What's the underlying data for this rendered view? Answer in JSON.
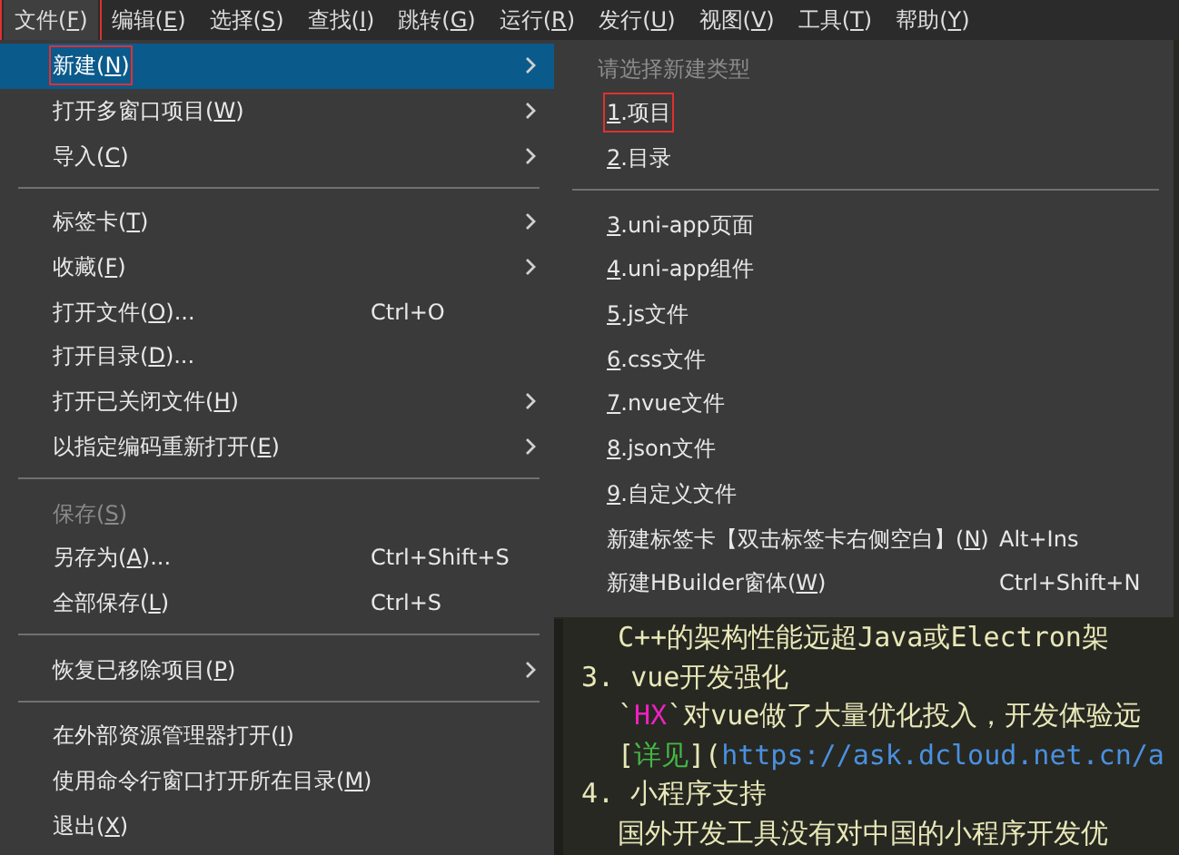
{
  "menubar": [
    {
      "pre": "文件(",
      "key": "F",
      "post": ")",
      "open": true,
      "annotated": true
    },
    {
      "pre": "编辑(",
      "key": "E",
      "post": ")",
      "open": false,
      "annotated": false
    },
    {
      "pre": "选择(",
      "key": "S",
      "post": ")",
      "open": false,
      "annotated": false
    },
    {
      "pre": "查找(",
      "key": "I",
      "post": ")",
      "open": false,
      "annotated": false
    },
    {
      "pre": "跳转(",
      "key": "G",
      "post": ")",
      "open": false,
      "annotated": false
    },
    {
      "pre": "运行(",
      "key": "R",
      "post": ")",
      "open": false,
      "annotated": false
    },
    {
      "pre": "发行(",
      "key": "U",
      "post": ")",
      "open": false,
      "annotated": false
    },
    {
      "pre": "视图(",
      "key": "V",
      "post": ")",
      "open": false,
      "annotated": false
    },
    {
      "pre": "工具(",
      "key": "T",
      "post": ")",
      "open": false,
      "annotated": false
    },
    {
      "pre": "帮助(",
      "key": "Y",
      "post": ")",
      "open": false,
      "annotated": false
    }
  ],
  "file_menu": [
    {
      "kind": "item",
      "pre": "新建(",
      "key": "N",
      "post": ")",
      "submenu": true,
      "selected": true,
      "disabled": false,
      "annotated": true
    },
    {
      "kind": "item",
      "pre": "打开多窗口项目(",
      "key": "W",
      "post": ")",
      "submenu": true,
      "selected": false,
      "disabled": false,
      "annotated": false
    },
    {
      "kind": "item",
      "pre": "导入(",
      "key": "C",
      "post": ")",
      "submenu": true,
      "selected": false,
      "disabled": false,
      "annotated": false
    },
    {
      "kind": "separator"
    },
    {
      "kind": "item",
      "pre": "标签卡(",
      "key": "T",
      "post": ")",
      "submenu": true,
      "selected": false,
      "disabled": false,
      "annotated": false
    },
    {
      "kind": "item",
      "pre": "收藏(",
      "key": "F",
      "post": ")",
      "submenu": true,
      "selected": false,
      "disabled": false,
      "annotated": false
    },
    {
      "kind": "item",
      "pre": "打开文件(",
      "key": "O",
      "post": ")...",
      "shortcut": "Ctrl+O",
      "submenu": false,
      "selected": false,
      "disabled": false,
      "annotated": false
    },
    {
      "kind": "item",
      "pre": "打开目录(",
      "key": "D",
      "post": ")...",
      "submenu": false,
      "selected": false,
      "disabled": false,
      "annotated": false
    },
    {
      "kind": "item",
      "pre": "打开已关闭文件(",
      "key": "H",
      "post": ")",
      "submenu": true,
      "selected": false,
      "disabled": false,
      "annotated": false
    },
    {
      "kind": "item",
      "pre": "以指定编码重新打开(",
      "key": "E",
      "post": ")",
      "submenu": true,
      "selected": false,
      "disabled": false,
      "annotated": false
    },
    {
      "kind": "separator"
    },
    {
      "kind": "item",
      "pre": "保存(",
      "key": "S",
      "post": ")",
      "submenu": false,
      "selected": false,
      "disabled": true,
      "annotated": false
    },
    {
      "kind": "item",
      "pre": "另存为(",
      "key": "A",
      "post": ")...",
      "shortcut": "Ctrl+Shift+S",
      "submenu": false,
      "selected": false,
      "disabled": false,
      "annotated": false
    },
    {
      "kind": "item",
      "pre": "全部保存(",
      "key": "L",
      "post": ")",
      "shortcut": "Ctrl+S",
      "submenu": false,
      "selected": false,
      "disabled": false,
      "annotated": false
    },
    {
      "kind": "separator"
    },
    {
      "kind": "item",
      "pre": "恢复已移除项目(",
      "key": "P",
      "post": ")",
      "submenu": true,
      "selected": false,
      "disabled": false,
      "annotated": false
    },
    {
      "kind": "separator"
    },
    {
      "kind": "item",
      "pre": "在外部资源管理器打开(",
      "key": "I",
      "post": ")",
      "submenu": false,
      "selected": false,
      "disabled": false,
      "annotated": false
    },
    {
      "kind": "item",
      "pre": "使用命令行窗口打开所在目录(",
      "key": "M",
      "post": ")",
      "submenu": false,
      "selected": false,
      "disabled": false,
      "annotated": false
    },
    {
      "kind": "item",
      "pre": "退出(",
      "key": "X",
      "post": ")",
      "submenu": false,
      "selected": false,
      "disabled": false,
      "annotated": false
    }
  ],
  "new_submenu": [
    {
      "kind": "header",
      "text": "请选择新建类型"
    },
    {
      "kind": "item",
      "key": "1",
      "post": ".项目",
      "annotated": true
    },
    {
      "kind": "item",
      "key": "2",
      "post": ".目录",
      "annotated": false
    },
    {
      "kind": "separator"
    },
    {
      "kind": "item",
      "key": "3",
      "post": ".uni-app页面",
      "annotated": false
    },
    {
      "kind": "item",
      "key": "4",
      "post": ".uni-app组件",
      "annotated": false
    },
    {
      "kind": "item",
      "key": "5",
      "post": ".js文件",
      "annotated": false
    },
    {
      "kind": "item",
      "key": "6",
      "post": ".css文件",
      "annotated": false
    },
    {
      "kind": "item",
      "key": "7",
      "post": ".nvue文件",
      "annotated": false
    },
    {
      "kind": "item",
      "key": "8",
      "post": ".json文件",
      "annotated": false
    },
    {
      "kind": "item",
      "key": "9",
      "post": ".自定义文件",
      "annotated": false
    },
    {
      "kind": "item",
      "pre": "新建标签卡【双击标签卡右侧空白】(",
      "key": "N",
      "post": ")",
      "shortcut": "Alt+Ins",
      "annotated": false
    },
    {
      "kind": "item",
      "pre": "新建HBuilder窗体(",
      "key": "W",
      "post": ")",
      "shortcut": "Ctrl+Shift+N",
      "annotated": false
    }
  ],
  "editor_lines": [
    [
      {
        "kind": "text",
        "text": "C++的架构性能远超Java或Electron架"
      }
    ],
    [
      {
        "kind": "text",
        "text": "3. vue开发强化"
      }
    ],
    [
      {
        "kind": "text",
        "text": "`"
      },
      {
        "kind": "code",
        "text": "HX"
      },
      {
        "kind": "text",
        "text": "`对vue做了大量优化投入，开发体验远"
      }
    ],
    [
      {
        "kind": "text",
        "text": "["
      },
      {
        "kind": "link_text",
        "text": "详见"
      },
      {
        "kind": "text",
        "text": "]("
      },
      {
        "kind": "url",
        "text": "https://ask.dcloud.net.cn/a"
      }
    ],
    [
      {
        "kind": "text",
        "text": "4. 小程序支持"
      }
    ],
    [
      {
        "kind": "text",
        "text": "国外开发工具没有对中国的小程序开发优"
      }
    ]
  ]
}
